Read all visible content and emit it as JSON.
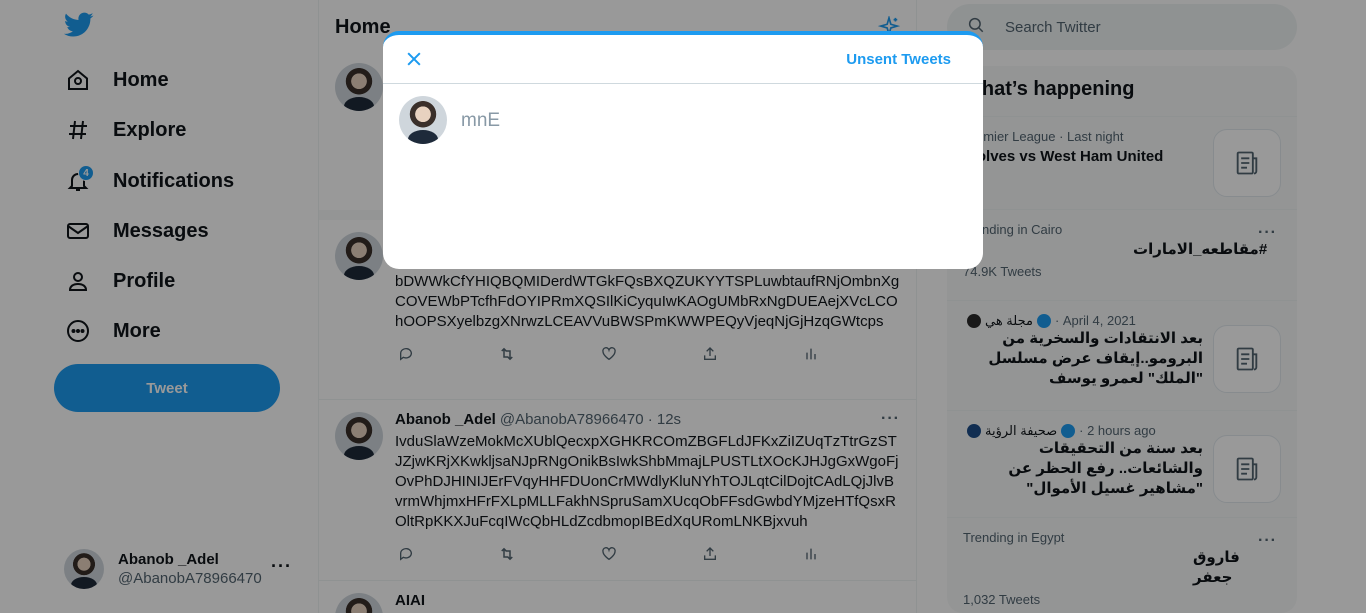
{
  "nav": {
    "logo": "twitter-bird-icon",
    "items": [
      {
        "label": "Home",
        "icon": "home-icon"
      },
      {
        "label": "Explore",
        "icon": "hashtag-icon"
      },
      {
        "label": "Notifications",
        "icon": "bell-icon",
        "badge": "4"
      },
      {
        "label": "Messages",
        "icon": "envelope-icon"
      },
      {
        "label": "Profile",
        "icon": "person-icon"
      },
      {
        "label": "More",
        "icon": "more-circle-icon"
      }
    ],
    "tweet_button": "Tweet",
    "account": {
      "name": "Abanob _Adel",
      "handle": "@AbanobA78966470",
      "more": "···"
    }
  },
  "timeline": {
    "title": "Home",
    "tweets": [
      {
        "name": "",
        "meta": "",
        "text": "VvFokIdAqjPNvBiPRvjzUwxYeohSDIQjAXVHrKncbYZGeAfbdiczwsvuytmNfoqWWIMaOCJkRBtyjAlxhnjoDQSSbkaijpVvnoBgtLMckCCYXkqoRDmZQDbDWWkCfYHIQBQMIDerdWTGkFQsBXQZUKYYTSPLuwbtaufRNjOmbnXgCOVEWbPTcfhFdOYIPRmXQSIlKiCyquIwKAOgUMbRxNgDUEAejXVcLCOhOOPSXyelbzgXNrwzLCEAVVuBWSPmKWWPEQyVjeqNjGjHzqGWtcps"
      },
      {
        "name": "Abanob _Adel",
        "meta": "@AbanobA78966470 · 12s",
        "text": "IvduSlaWzeMokMcXUblQecxpXGHKRCOmZBGFLdJFKxZiIZUqTzTtrGzSTJZjwKRjXKwkljsaNJpRNgOnikBsIwkShbMmajLPUSTLtXOcKJHJgGxWgoFjOvPhDJHINIJErFVqyHHFDUonCrMWdlyKluNYhTOJLqtCilDojtCAdLQjJlvBvrmWhjmxHFrFXLpMLLFakhNSpruSamXUcqObFFsdGwbdYMjzeHTfQsxROltRpKKXJuFcqIWcQbHLdZcdbmopIBEdXqURomLNKBjxvuh"
      }
    ],
    "partial_row": "AIAI"
  },
  "right": {
    "search_placeholder": "Search Twitter",
    "section_title": "What’s happening",
    "trends": [
      {
        "sub": "Premier League · Last night",
        "main": "Wolves vs West Ham United"
      },
      {
        "sub": "Trending in Cairo",
        "main": "#مقاطعه_الامارات",
        "count": "74.9K Tweets"
      },
      {
        "source": "مجلة هي",
        "date": "April 4, 2021",
        "main": "بعد الانتقادات والسخرية من البرومو..إيقاف عرض مسلسل \"الملك\" لعمرو يوسف"
      },
      {
        "source": "صحيفة الرؤية",
        "date": "2 hours ago",
        "main": "بعد سنة من التحقيقات والشائعات.. رفع الحظر عن \"مشاهير غسيل الأموال\""
      },
      {
        "sub": "Trending in Egypt",
        "main": "فاروق جعفر",
        "count": "1,032 Tweets"
      }
    ]
  },
  "modal": {
    "unsent_label": "Unsent Tweets",
    "input_value": "mnE",
    "accent": "#1d9bf0"
  }
}
